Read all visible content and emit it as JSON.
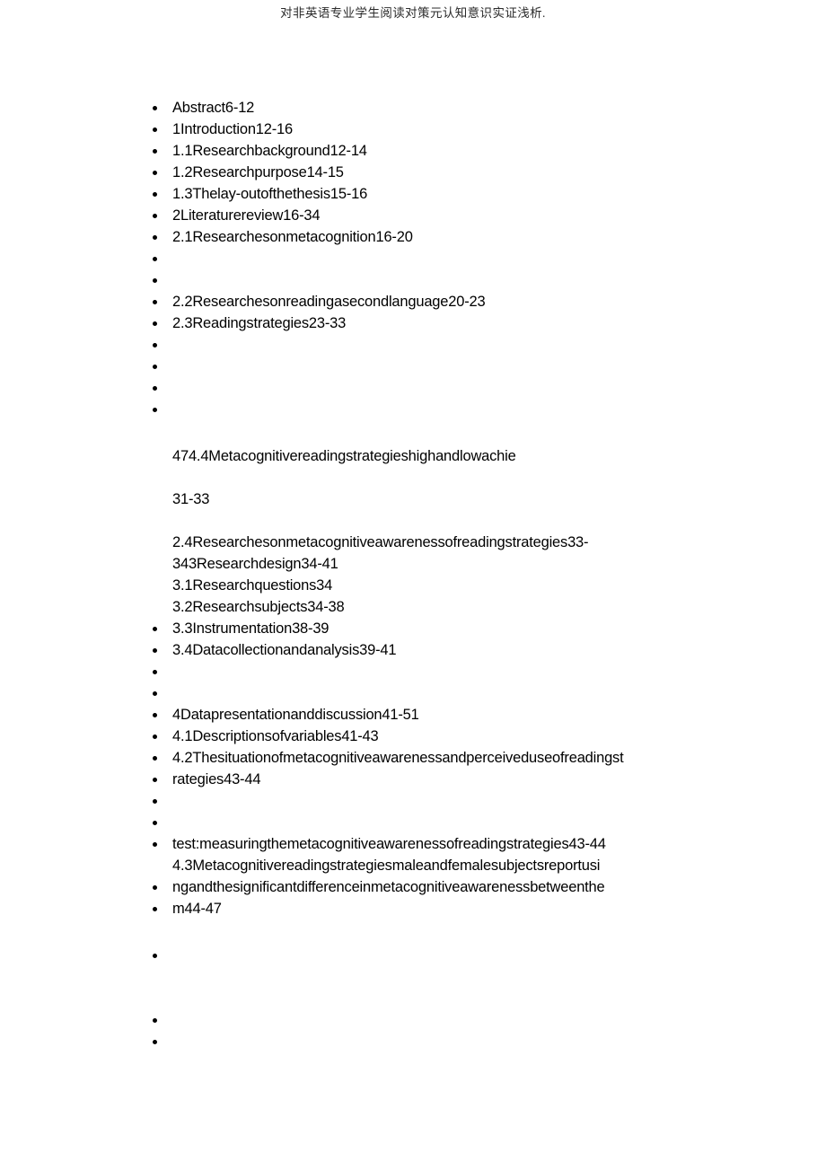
{
  "header": {
    "running_title": "对非英语专业学生阅读对策元认知意识实证浅析."
  },
  "document": {
    "type": "table-of-contents",
    "bullet_glyph": "•",
    "text_color": "#000000",
    "background_color": "#ffffff",
    "entries": [
      {
        "text": "Abstract6-12",
        "bullet": true
      },
      {
        "text": "1Introduction12-16",
        "bullet": true
      },
      {
        "text": "1.1Researchbackground12-14",
        "bullet": true
      },
      {
        "text": "1.2Researchpurpose14-15",
        "bullet": true
      },
      {
        "text": "1.3Thelay-outofthethesis15-16",
        "bullet": true
      },
      {
        "text": "2Literaturereview16-34",
        "bullet": true
      },
      {
        "text": "2.1Researchesonmetacognition16-20",
        "bullet": true
      },
      {
        "text": "",
        "bullet": true
      },
      {
        "text": "",
        "bullet": true
      },
      {
        "text": "2.2Researchesonreadingasecondlanguage20-23",
        "bullet": true
      },
      {
        "text": "2.3Readingstrategies23-33",
        "bullet": true
      },
      {
        "text": "",
        "bullet": true
      },
      {
        "text": "",
        "bullet": true
      },
      {
        "text": "",
        "bullet": true
      },
      {
        "text": "",
        "bullet": true
      },
      {
        "text": "474.4Metacognitivereadingstrategieshighandlowachie",
        "bullet": false
      },
      {
        "text": "31-33",
        "bullet": false
      },
      {
        "text": "2.4Researchesonmetacognitiveawarenessofreadingstrategies33-",
        "bullet": false
      },
      {
        "text": "343Researchdesign34-41",
        "bullet": false
      },
      {
        "text": "3.1Researchquestions34",
        "bullet": false
      },
      {
        "text": "3.2Researchsubjects34-38",
        "bullet": false
      },
      {
        "text": "3.3Instrumentation38-39",
        "bullet": true
      },
      {
        "text": "3.4Datacollectionandanalysis39-41",
        "bullet": true
      },
      {
        "text": "",
        "bullet": true
      },
      {
        "text": "",
        "bullet": true
      },
      {
        "text": "4Datapresentationanddiscussion41-51",
        "bullet": true
      },
      {
        "text": "4.1Descriptionsofvariables41-43",
        "bullet": true
      },
      {
        "text": "4.2Thesituationofmetacognitiveawarenessandperceiveduseofreadingst",
        "bullet": true
      },
      {
        "text": "rategies43-44",
        "bullet": true
      },
      {
        "text": "",
        "bullet": true
      },
      {
        "text": "",
        "bullet": true
      },
      {
        "text": "test:measuringthemetacognitiveawarenessofreadingstrategies43-44",
        "bullet": true
      },
      {
        "text": "4.3Metacognitivereadingstrategiesmaleandfemalesubjectsreportusi",
        "bullet": false
      },
      {
        "text": "ngandthesignificantdifferenceinmetacognitiveawarenessbetweenthe",
        "bullet": true
      },
      {
        "text": "m44-47",
        "bullet": true
      },
      {
        "text": "",
        "bullet": true
      },
      {
        "text": "",
        "bullet": true
      },
      {
        "text": "",
        "bullet": true
      }
    ]
  }
}
